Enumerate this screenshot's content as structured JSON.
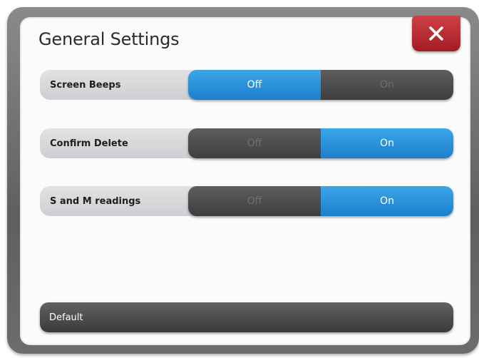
{
  "dialog": {
    "title": "General Settings",
    "close_icon": "close-icon"
  },
  "settings": [
    {
      "label": "Screen Beeps",
      "off_label": "Off",
      "on_label": "On",
      "value": "Off"
    },
    {
      "label": "Confirm Delete",
      "off_label": "Off",
      "on_label": "On",
      "value": "On"
    },
    {
      "label": "S and M readings",
      "off_label": "Off",
      "on_label": "On",
      "value": "On"
    }
  ],
  "footer": {
    "default_label": "Default"
  },
  "colors": {
    "active": "#1e8ad6",
    "inactive": "#4a4a4c",
    "close": "#b8262e",
    "frame": "#6e6e6e"
  }
}
